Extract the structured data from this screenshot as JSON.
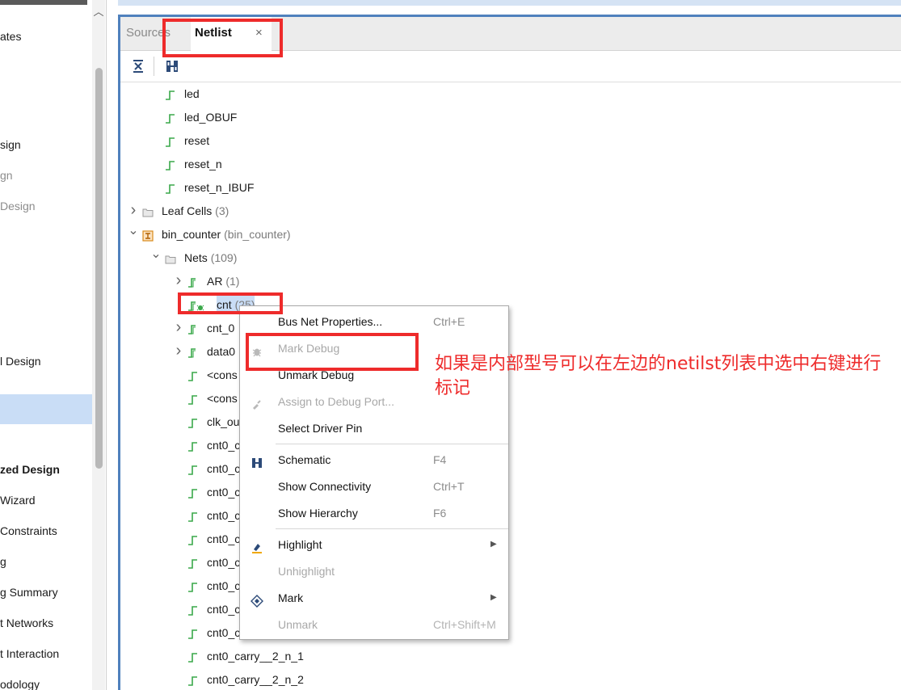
{
  "left_nav": {
    "items": [
      {
        "label": "ates",
        "style": "normal"
      },
      {
        "label": "sign",
        "style": "normal"
      },
      {
        "label": "gn",
        "style": "dim"
      },
      {
        "label": "Design",
        "style": "dim"
      },
      {
        "label": "l Design",
        "style": "normal"
      },
      {
        "label": "zed Design",
        "style": "bold"
      },
      {
        "label": "Wizard",
        "style": "normal"
      },
      {
        "label": "Constraints",
        "style": "normal"
      },
      {
        "label": "g",
        "style": "normal"
      },
      {
        "label": "g Summary",
        "style": "normal"
      },
      {
        "label": "t Networks",
        "style": "normal"
      },
      {
        "label": "t Interaction",
        "style": "normal"
      },
      {
        "label": "odology",
        "style": "normal"
      }
    ]
  },
  "tabs": {
    "sources_label": "Sources",
    "netlist_label": "Netlist",
    "close_glyph": "×"
  },
  "toolbar": {
    "collapse_all_icon": "collapse-all-icon",
    "schematic_icon": "schematic-icon"
  },
  "tree": {
    "rows": [
      {
        "label": "led",
        "count": "",
        "icon": "net-icon"
      },
      {
        "label": "led_OBUF",
        "count": "",
        "icon": "net-icon"
      },
      {
        "label": "reset",
        "count": "",
        "icon": "net-icon"
      },
      {
        "label": "reset_n",
        "count": "",
        "icon": "net-icon"
      },
      {
        "label": "reset_n_IBUF",
        "count": "",
        "icon": "net-icon"
      },
      {
        "label": "Leaf Cells",
        "count": "(3)",
        "icon": "folder-icon"
      },
      {
        "label": "bin_counter",
        "count": "(bin_counter)",
        "icon": "cell-icon"
      },
      {
        "label": "Nets",
        "count": "(109)",
        "icon": "folder-icon"
      },
      {
        "label": "AR",
        "count": "(1)",
        "icon": "bus-net-icon"
      },
      {
        "label": "cnt",
        "count": "(25)",
        "icon": "bus-net-debug-icon"
      },
      {
        "label": "cnt_0",
        "count": "",
        "icon": "bus-net-icon"
      },
      {
        "label": "data0",
        "count": "",
        "icon": "bus-net-icon"
      },
      {
        "label": "<cons",
        "count": "",
        "icon": "net-icon"
      },
      {
        "label": "<cons",
        "count": "",
        "icon": "net-icon"
      },
      {
        "label": "clk_ou",
        "count": "",
        "icon": "net-icon"
      },
      {
        "label": "cnt0_c",
        "count": "",
        "icon": "net-icon"
      },
      {
        "label": "cnt0_c",
        "count": "",
        "icon": "net-icon"
      },
      {
        "label": "cnt0_c",
        "count": "",
        "icon": "net-icon"
      },
      {
        "label": "cnt0_c",
        "count": "",
        "icon": "net-icon"
      },
      {
        "label": "cnt0_c",
        "count": "",
        "icon": "net-icon"
      },
      {
        "label": "cnt0_c",
        "count": "",
        "icon": "net-icon"
      },
      {
        "label": "cnt0_c",
        "count": "",
        "icon": "net-icon"
      },
      {
        "label": "cnt0_c",
        "count": "",
        "icon": "net-icon"
      },
      {
        "label": "cnt0_c",
        "count": "",
        "icon": "net-icon"
      },
      {
        "label": "cnt0_carry__2_n_1",
        "count": "",
        "icon": "net-icon"
      },
      {
        "label": "cnt0_carry__2_n_2",
        "count": "",
        "icon": "net-icon"
      }
    ]
  },
  "context_menu": {
    "items": [
      {
        "label": "Bus Net Properties...",
        "shortcut": "Ctrl+E",
        "enabled": true
      },
      {
        "label": "Mark Debug",
        "shortcut": "",
        "enabled": false
      },
      {
        "label": "Unmark Debug",
        "shortcut": "",
        "enabled": true
      },
      {
        "label": "Assign to Debug Port...",
        "shortcut": "",
        "enabled": false
      },
      {
        "label": "Select Driver Pin",
        "shortcut": "",
        "enabled": true
      },
      {
        "label": "Schematic",
        "shortcut": "F4",
        "enabled": true
      },
      {
        "label": "Show Connectivity",
        "shortcut": "Ctrl+T",
        "enabled": true
      },
      {
        "label": "Show Hierarchy",
        "shortcut": "F6",
        "enabled": true
      },
      {
        "label": "Highlight",
        "shortcut": "",
        "enabled": true,
        "submenu": true
      },
      {
        "label": "Unhighlight",
        "shortcut": "",
        "enabled": false
      },
      {
        "label": "Mark",
        "shortcut": "",
        "enabled": true,
        "submenu": true
      },
      {
        "label": "Unmark",
        "shortcut": "Ctrl+Shift+M",
        "enabled": false
      }
    ]
  },
  "annotation": {
    "text": "如果是内部型号可以在左边的netilst列表中选中右键进行标记",
    "color": "#ee2b2b"
  },
  "colors": {
    "accent": "#4f81bd",
    "selection": "#c9ddf6",
    "net_green": "#3aa84a",
    "annotation_red": "#ee2b2b"
  }
}
